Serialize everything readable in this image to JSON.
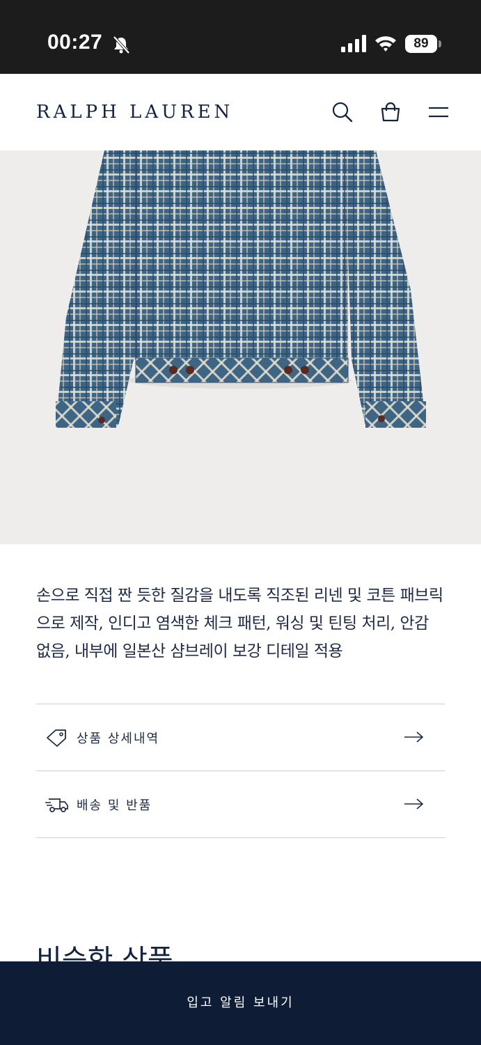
{
  "status_bar": {
    "time": "00:27",
    "battery": "89",
    "icons": [
      "mute-bell-icon",
      "cellular-signal-icon",
      "wifi-icon",
      "battery-icon"
    ]
  },
  "header": {
    "brand": "RALPH LAUREN",
    "icons": [
      "search-icon",
      "shopping-bag-icon",
      "menu-icon"
    ]
  },
  "product": {
    "description": "손으로 직접 짠 듯한 질감을 내도록 직조된 리넨 및 코튼 패브릭으로 제작, 인디고 염색한 체크 패턴, 워싱 및 틴팅 처리, 안감 없음, 내부에 일본산 샴브레이 보강 디테일 적용"
  },
  "accordion": [
    {
      "label": "상품 상세내역",
      "icon": "price-tag-icon"
    },
    {
      "label": "배송 및 반품",
      "icon": "delivery-truck-icon"
    }
  ],
  "similar": {
    "title": "비슷한 상품"
  },
  "bottom_bar": {
    "button_label": "입고 알림 보내기"
  },
  "colors": {
    "navy": "#0e1d35",
    "text": "#1f2a44",
    "image_bg": "#eeedeb",
    "plaid_blue": "#3f6585",
    "plaid_cream": "#e7e1cf"
  }
}
